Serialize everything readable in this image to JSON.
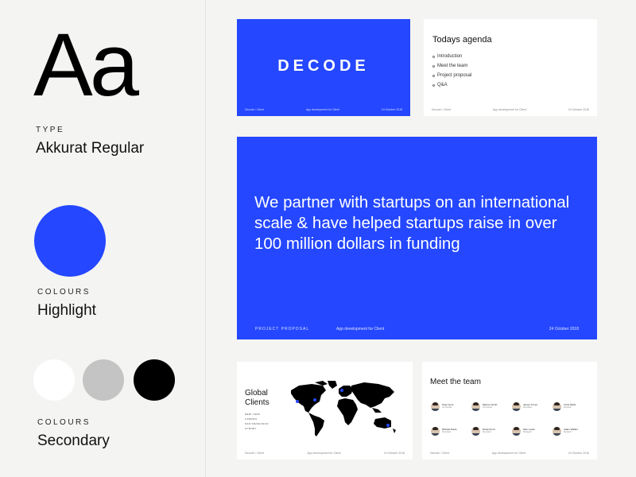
{
  "typography": {
    "specimen": "Aa",
    "caption": "TYPE",
    "name": "Akkurat Regular"
  },
  "highlight": {
    "caption": "COLOURS",
    "name": "Highlight",
    "color": "#2447ff"
  },
  "secondary": {
    "caption": "COLOURS",
    "name": "Secondary",
    "colors": [
      "#ffffff",
      "#c4c4c4",
      "#000000"
    ]
  },
  "slides": {
    "cover": {
      "logo": "DECODE",
      "footer_left": "Decode / Client",
      "footer_center": "App development for Client",
      "footer_right": "24 October 2018"
    },
    "agenda": {
      "title": "Todays agenda",
      "items": [
        "Introduction",
        "Meet the team",
        "Project proposal",
        "Q&A"
      ],
      "footer_left": "Decode / Client",
      "footer_center": "App development for Client",
      "footer_right": "24 October 2018"
    },
    "statement": {
      "text": "We partner with startups on an international scale & have helped startups raise in over 100 million dollars in funding",
      "footer_left": "PROJECT PROPOSAL",
      "footer_center": "App development for Client",
      "footer_right": "24 October 2018"
    },
    "global": {
      "title_line1": "Global",
      "title_line2": "Clients",
      "cities": [
        "NEW YORK",
        "LONDON",
        "SAN FRANCISCO",
        "SYDNEY"
      ],
      "footer_left": "Decode / Client",
      "footer_center": "App development for Client",
      "footer_right": "24 October 2018"
    },
    "team": {
      "title": "Meet the team",
      "members": [
        {
          "name": "Peter Hunt",
          "role": "Co-founder"
        },
        {
          "name": "Marcus Smith",
          "role": "Co-founder"
        },
        {
          "name": "James Turner",
          "role": "Developer"
        },
        {
          "name": "Chris Wells",
          "role": "Designer"
        },
        {
          "name": "Michael Davis",
          "role": "Developer"
        },
        {
          "name": "Daniel Ford",
          "role": "Developer"
        },
        {
          "name": "Sam Lewis",
          "role": "Strategist"
        },
        {
          "name": "Adam Walker",
          "role": "Designer"
        }
      ],
      "footer_left": "Decode / Client",
      "footer_center": "App development for Client",
      "footer_right": "24 October 2018"
    }
  }
}
